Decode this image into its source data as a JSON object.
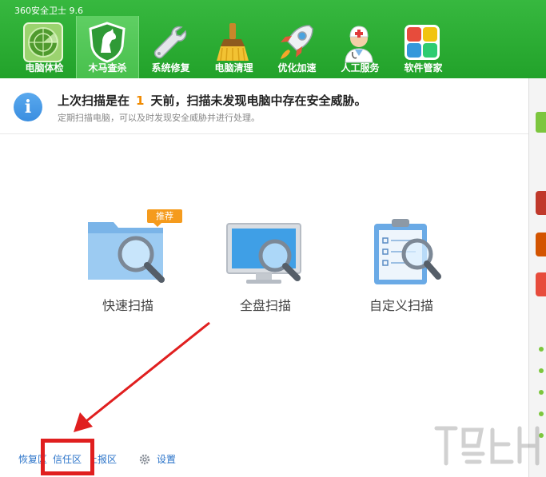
{
  "app": {
    "title": "360安全卫士 9.6"
  },
  "toolbar": {
    "items": [
      {
        "label": "电脑体检",
        "icon": "radar-icon"
      },
      {
        "label": "木马查杀",
        "icon": "horse-shield-icon"
      },
      {
        "label": "系统修复",
        "icon": "wrench-icon"
      },
      {
        "label": "电脑清理",
        "icon": "broom-icon"
      },
      {
        "label": "优化加速",
        "icon": "rocket-icon"
      },
      {
        "label": "人工服务",
        "icon": "doctor-icon"
      },
      {
        "label": "软件管家",
        "icon": "app-grid-icon"
      }
    ],
    "active_index": 1
  },
  "info": {
    "icon": "info-icon",
    "text_before": "上次扫描是在",
    "days": "1",
    "text_after": "天前，扫描未发现电脑中存在安全威胁。",
    "subtext": "定期扫描电脑，可以及时发现安全威胁并进行处理。"
  },
  "scan_options": [
    {
      "label": "快速扫描",
      "icon": "folder-magnifier-icon",
      "badge": "推荐"
    },
    {
      "label": "全盘扫描",
      "icon": "monitor-magnifier-icon"
    },
    {
      "label": "自定义扫描",
      "icon": "clipboard-magnifier-icon"
    }
  ],
  "bottom_links": {
    "restore": "恢复区",
    "trust": "信任区",
    "report": "上报区",
    "settings": "设置"
  },
  "colors": {
    "header_green": "#2aa832",
    "highlight_red": "#e01f1f",
    "link_blue": "#2a73c9",
    "badge_orange": "#f59b1d",
    "days_orange": "#f08a00"
  }
}
